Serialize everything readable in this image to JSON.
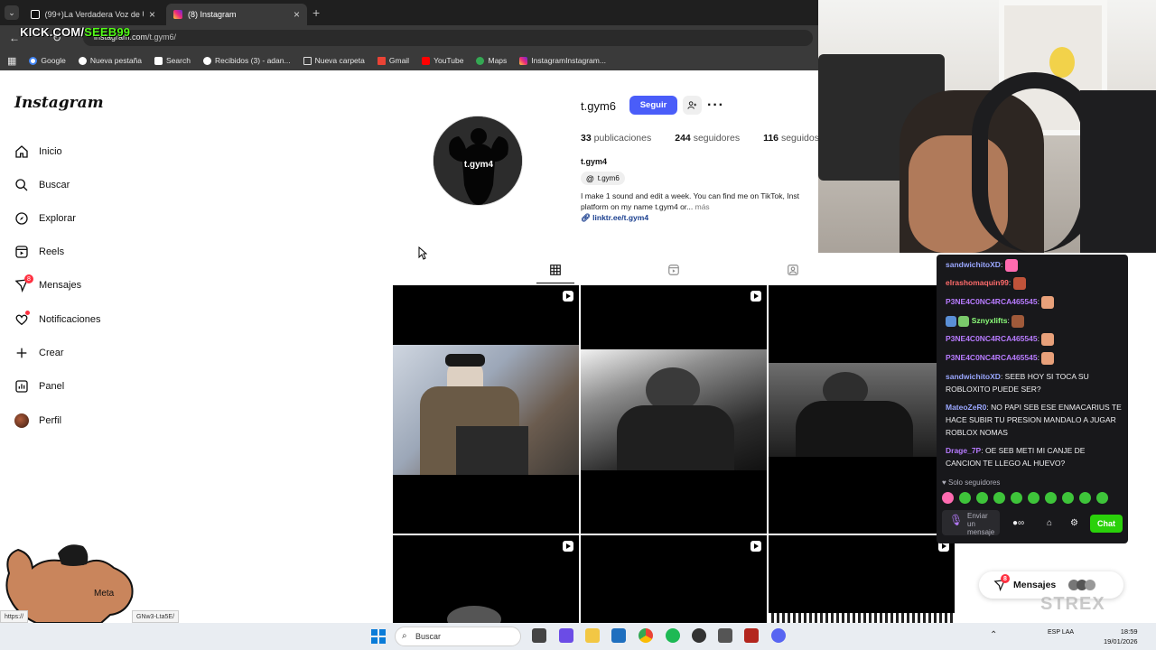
{
  "browser": {
    "tabs": [
      {
        "label": "(99+)La Verdadera Voz de Uch..."
      },
      {
        "label": "(8) Instagram"
      }
    ],
    "url_host": "instagram.com",
    "url_path": "/t.gym6/",
    "bookmarks": [
      "Google",
      "Nueva pestaña",
      "Search",
      "Recibidos (3) - adan...",
      "Nueva carpeta",
      "Gmail",
      "YouTube",
      "Maps",
      "InstagramInstagram..."
    ]
  },
  "overlay": {
    "kick_prefix": "KICK.COM/",
    "kick_user": "SEEB99"
  },
  "sidebar": {
    "logo": "Instagram",
    "items": [
      {
        "label": "Inicio",
        "icon": "home-icon"
      },
      {
        "label": "Buscar",
        "icon": "search-icon"
      },
      {
        "label": "Explorar",
        "icon": "explore-icon"
      },
      {
        "label": "Reels",
        "icon": "reels-icon"
      },
      {
        "label": "Mensajes",
        "icon": "messages-icon",
        "badge": "8"
      },
      {
        "label": "Notificaciones",
        "icon": "heart-icon"
      },
      {
        "label": "Crear",
        "icon": "plus-icon"
      },
      {
        "label": "Panel",
        "icon": "dashboard-icon"
      },
      {
        "label": "Perfil",
        "icon": "avatar-icon"
      }
    ],
    "more_label": "Meta"
  },
  "profile": {
    "username": "t.gym6",
    "follow_label": "Seguir",
    "posts_count": "33",
    "posts_label": "publicaciones",
    "followers_count": "244",
    "followers_label": "seguidores",
    "following_count": "116",
    "following_label": "seguidos",
    "fullname": "t.gym4",
    "threads_handle": "t.gym6",
    "pic_text": "t.gym4",
    "bio": "I make 1 sound and edit a week. You can find me on TikTok, Inst",
    "bio_line2": "platform on my name t.gym4 or...",
    "bio_more": "más",
    "link": "linktr.ee/t.gym4"
  },
  "chat": {
    "messages": [
      {
        "user": "sandwichitoXD",
        "text": "",
        "color": "#9aa7ff"
      },
      {
        "user": "elrashomaquin99",
        "text": "",
        "color": "#ff6b6b"
      },
      {
        "user": "P3NE4C0NC4RCA465545",
        "text": "",
        "color": "#b77bff"
      },
      {
        "user": "Sznyxlifts",
        "text": "",
        "color": "#8cff7a"
      },
      {
        "user": "P3NE4C0NC4RCA465545",
        "text": "",
        "color": "#b77bff"
      },
      {
        "user": "P3NE4C0NC4RCA465545",
        "text": "",
        "color": "#b77bff"
      },
      {
        "user": "sandwichitoXD",
        "text": "SEEB HOY SI TOCA SU ROBLOXITO PUEDE SER?",
        "color": "#9aa7ff"
      },
      {
        "user": "MateoZeR0",
        "text": "NO PAPI SEB ESE ENMACARIUS TE HACE SUBIR TU PRESION MANDALO A JUGAR ROBLOX NOMAS",
        "color": "#9aa7ff"
      },
      {
        "user": "Drage_7P",
        "text": "OE SEB METI MI CANJE DE CANCION TE LLEGO AL HUEVO?",
        "color": "#b77bff"
      }
    ],
    "followers_only": "Solo seguidores",
    "input_placeholder": "Enviar un mensaje",
    "chat_button": "Chat"
  },
  "messages_pill": {
    "label": "Mensajes",
    "badge": "8"
  },
  "taskbar": {
    "search_placeholder": "Buscar",
    "time": "18:59",
    "date": "19/01/2026",
    "lang": "ESP LAA"
  },
  "status": {
    "url_left": "https://",
    "url_right": "GNw3-Lta5E/"
  },
  "watermark": "STREX"
}
